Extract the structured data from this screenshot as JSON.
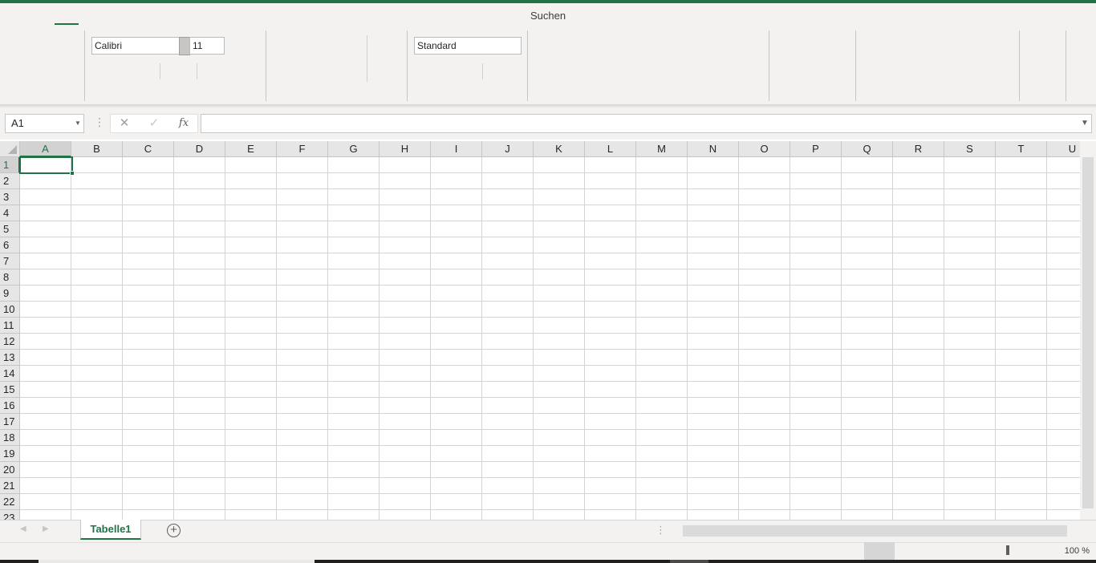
{
  "app": {
    "accent_color": "#217346",
    "search_label": "Suchen"
  },
  "ribbon": {
    "font_name": "Calibri",
    "font_size": "11",
    "number_format": "Standard"
  },
  "formula_bar": {
    "name_box": "A1",
    "fx_label": "fx",
    "formula_value": "",
    "icons": [
      "cancel-icon",
      "enter-icon",
      "insert-function-icon"
    ]
  },
  "grid": {
    "columns": [
      "A",
      "B",
      "C",
      "D",
      "E",
      "F",
      "G",
      "H",
      "I",
      "J",
      "K",
      "L",
      "M",
      "N",
      "O",
      "P",
      "Q",
      "R",
      "S",
      "T",
      "U"
    ],
    "rows": [
      "1",
      "2",
      "3",
      "4",
      "5",
      "6",
      "7",
      "8",
      "9",
      "10",
      "11",
      "12",
      "13",
      "14",
      "15",
      "16",
      "17",
      "18",
      "19",
      "20",
      "21",
      "22",
      "23"
    ],
    "selected_cell": "A1"
  },
  "sheets": {
    "tabs": [
      "Tabelle1"
    ],
    "active": "Tabelle1"
  },
  "status_bar": {
    "zoom": "100 %"
  }
}
